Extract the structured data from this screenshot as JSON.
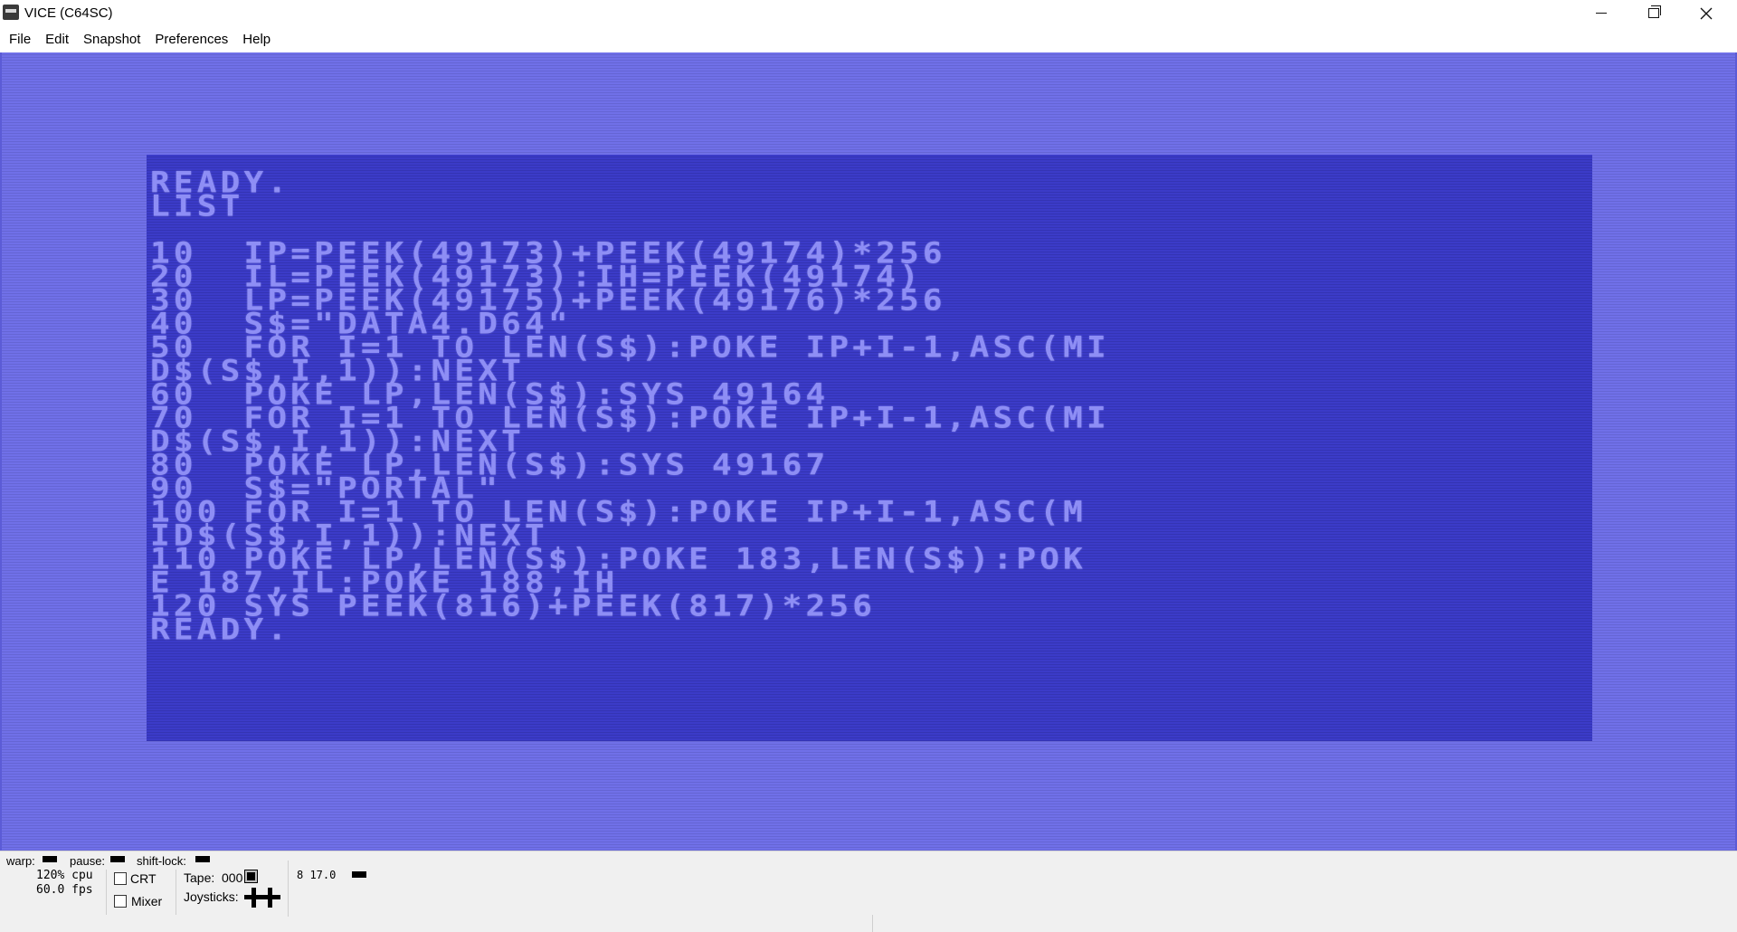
{
  "window": {
    "title": "VICE (C64SC)",
    "icon": "vice-app-icon",
    "controls": {
      "minimize": "minimize-icon",
      "maximize": "restore-icon",
      "close": "close-icon"
    }
  },
  "menu": {
    "items": [
      "File",
      "Edit",
      "Snapshot",
      "Preferences",
      "Help"
    ]
  },
  "screen": {
    "border_color": "#7070e8",
    "background_color": "#3b3bc8",
    "text_color": "#8e8ef5",
    "lines": [
      "READY.",
      "LIST",
      "",
      "10  IP=PEEK(49173)+PEEK(49174)*256",
      "20  IL=PEEK(49173):IH=PEEK(49174)",
      "30  LP=PEEK(49175)+PEEK(49176)*256",
      "40  S$=\"DATA4.D64\"",
      "50  FOR I=1 TO LEN(S$):POKE IP+I-1,ASC(MI",
      "D$(S$,I,1)):NEXT",
      "60  POKE LP,LEN(S$):SYS 49164",
      "70  FOR I=1 TO LEN(S$):POKE IP+I-1,ASC(MI",
      "D$(S$,I,1)):NEXT",
      "80  POKE LP,LEN(S$):SYS 49167",
      "90  S$=\"PORTAL\"",
      "100 FOR I=1 TO LEN(S$):POKE IP+I-1,ASC(M",
      "ID$(S$,I,1)):NEXT",
      "110 POKE LP,LEN(S$):POKE 183,LEN(S$):POK",
      "E 187,IL:POKE 188,IH",
      "120 SYS PEEK(816)+PEEK(817)*256",
      "READY."
    ]
  },
  "status": {
    "warp_label": "warp:",
    "pause_label": "pause:",
    "shiftlock_label": "shift-lock:",
    "cpu": "120% cpu",
    "fps": "60.0 fps",
    "crt_label": "CRT",
    "crt_checked": false,
    "mixer_label": "Mixer",
    "mixer_checked": false,
    "tape_label": "Tape:",
    "tape_counter": "000",
    "joysticks_label": "Joysticks:",
    "drive_label": "8 17.0"
  }
}
